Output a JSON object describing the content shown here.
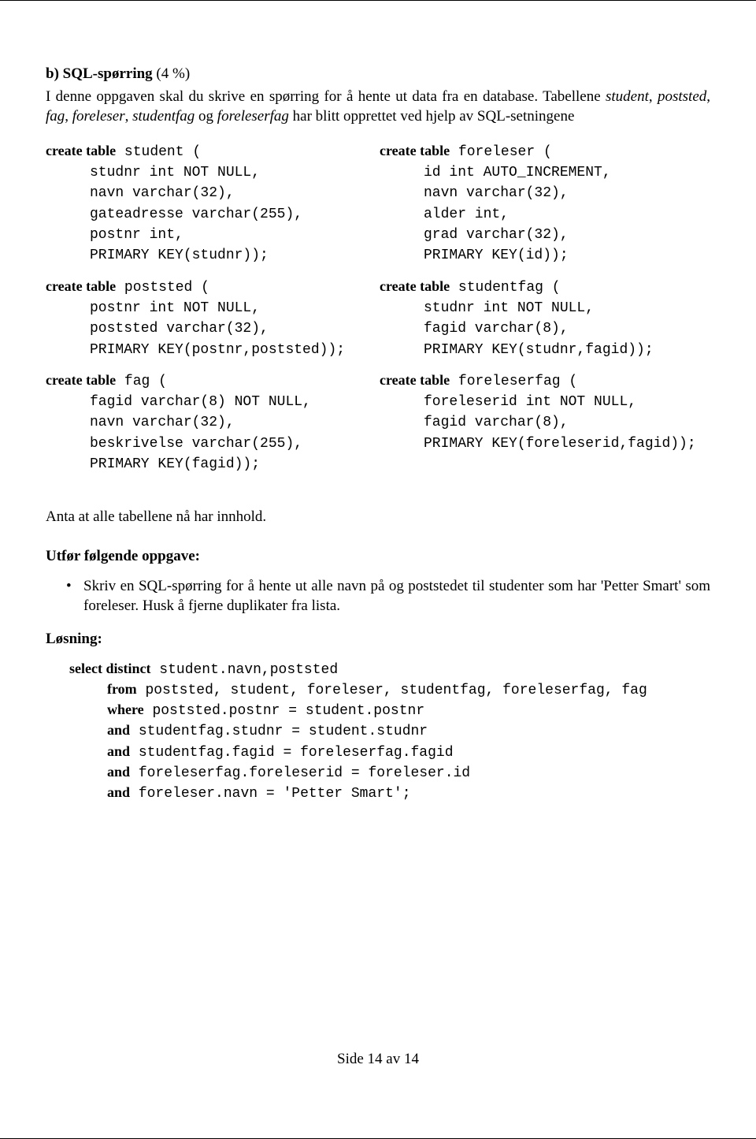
{
  "heading": {
    "label": "b) SQL-spørring",
    "weight": "(4 %)"
  },
  "intro": {
    "pre": "I denne oppgaven skal du skrive en spørring for å hente ut data fra en database. Tabellene ",
    "tables": [
      "student",
      "poststed",
      "fag",
      "foreleser",
      "studentfag",
      "foreleserfag"
    ],
    "sep_comma": ", ",
    "sep_og": " og ",
    "post": " har blitt opprettet ved hjelp av SQL-setningene"
  },
  "code": {
    "kw_create_table": "create table",
    "left": [
      {
        "head": " student (",
        "lines": [
          "studnr int NOT NULL,",
          "navn varchar(32),",
          "gateadresse varchar(255),",
          "postnr int,",
          "PRIMARY KEY(studnr));"
        ]
      },
      {
        "head": " poststed (",
        "lines": [
          "postnr int NOT NULL,",
          "poststed varchar(32),",
          "PRIMARY KEY(postnr,poststed));"
        ]
      },
      {
        "head": " fag (",
        "lines": [
          "fagid varchar(8) NOT NULL,",
          "navn varchar(32),",
          "beskrivelse varchar(255),",
          "PRIMARY KEY(fagid));"
        ]
      }
    ],
    "right": [
      {
        "head": " foreleser (",
        "lines": [
          "id int AUTO_INCREMENT,",
          "navn varchar(32),",
          "alder int,",
          "grad varchar(32),",
          "PRIMARY KEY(id));"
        ]
      },
      {
        "head": " studentfag (",
        "lines": [
          "studnr int NOT NULL,",
          "fagid varchar(8),",
          "PRIMARY KEY(studnr,fagid));"
        ]
      },
      {
        "head": " foreleserfag (",
        "lines": [
          "foreleserid int NOT NULL,",
          "fagid varchar(8),",
          "PRIMARY KEY(foreleserid,fagid));"
        ]
      }
    ]
  },
  "assume": "Anta at alle tabellene nå har innhold.",
  "task_label": "Utfør følgende oppgave:",
  "task_bullet": "Skriv en SQL-spørring for å hente ut alle navn på og poststedet til studenter som har 'Petter Smart' som foreleser. Husk å fjerne duplikater fra lista.",
  "solution_label": "Løsning:",
  "solution": {
    "kw_select_distinct": "select distinct",
    "head": " student.navn,poststed",
    "kw_from": "from",
    "from_rest": " poststed, student, foreleser, studentfag, foreleserfag, fag",
    "kw_where": "where",
    "where1": " poststed.postnr = student.postnr",
    "kw_and": "and",
    "and1": " studentfag.studnr = student.studnr",
    "and2": " studentfag.fagid = foreleserfag.fagid",
    "and3": " foreleserfag.foreleserid = foreleser.id",
    "and4": " foreleser.navn = 'Petter Smart';"
  },
  "page_number": "Side 14 av 14"
}
